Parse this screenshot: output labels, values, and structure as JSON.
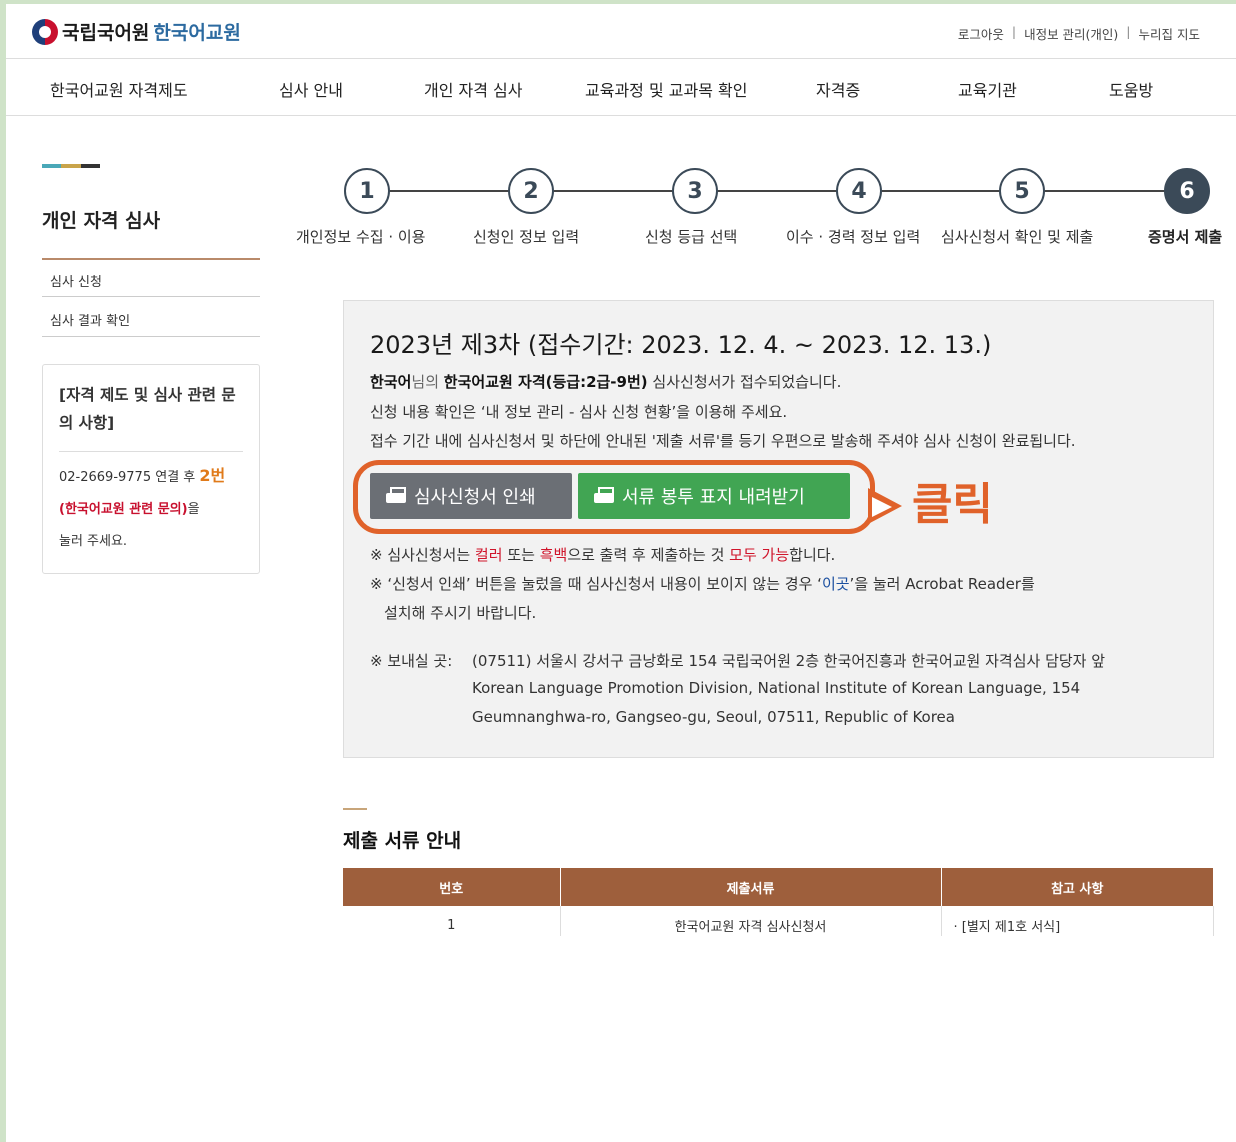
{
  "header": {
    "logo_main": "국립국어원",
    "logo_sub": "한국어교원",
    "util_links": [
      "로그아웃",
      "내정보 관리(개인)",
      "누리집 지도"
    ]
  },
  "gnb": [
    "한국어교원 자격제도",
    "심사 안내",
    "개인 자격 심사",
    "교육과정 및 교과목 확인",
    "자격증",
    "교육기관",
    "도움방"
  ],
  "sidebar": {
    "title": "개인 자격 심사",
    "links": [
      "심사 신청",
      "심사 결과 확인"
    ],
    "box_title": "[자격 제도 및 심사 관련 문의 사항]",
    "phone": "02-2669-9775",
    "phone_mid": "연결 후",
    "ext": "2번",
    "inquiry": "(한국어교원 관련 문의)",
    "inquiry_suffix": "을",
    "press": "눌러 주세요.",
    "deco_colors": [
      "#4aa8b8",
      "#c9a44a",
      "#333333"
    ]
  },
  "steps": [
    {
      "num": "1",
      "label": "개인정보 수집 · 이용"
    },
    {
      "num": "2",
      "label": "신청인 정보 입력"
    },
    {
      "num": "3",
      "label": "신청 등급 선택"
    },
    {
      "num": "4",
      "label": "이수 · 경력 정보 입력"
    },
    {
      "num": "5",
      "label": "심사신청서 확인 및 제출"
    },
    {
      "num": "6",
      "label": "증명서 제출",
      "active": true
    }
  ],
  "main": {
    "title": "2023년 제3차 (접수기간: 2023. 12. 4. ~ 2023. 12. 13.)",
    "line1_name": "한국어",
    "line1_nim": "님의",
    "line1_cert": "한국어교원 자격(등급:2급-9번)",
    "line1_rest": "심사신청서가 접수되었습니다.",
    "line2": "신청 내용 확인은 ‘내 정보 관리 - 심사 신청 현황’을 이용해 주세요.",
    "line3": "접수 기간 내에 심사신청서 및 하단에 안내된 '제출 서류'를 등기 우편으로 발송해 주셔야 심사 신청이 완료됩니다.",
    "btn_print": "심사신청서 인쇄",
    "btn_download": "서류 봉투 표지 내려받기",
    "callout": "클릭",
    "note1_a": "※  심사신청서는",
    "note1_color": "컬러",
    "note1_b": "또는",
    "note1_bw": "흑백",
    "note1_c": "으로 출력 후 제출하는 것",
    "note1_all": "모두 가능",
    "note1_d": "합니다.",
    "note2_a": "※ ‘신청서 인쇄’ 버튼을 눌렀을 때 심사신청서 내용이 보이지 않는 경우 ‘",
    "note2_link": "이곳",
    "note2_b": "’을 눌러 Acrobat Reader를",
    "note2_c": "설치해 주시기 바랍니다.",
    "addr_label": "※ 보내실 곳:",
    "addr_kr": "(07511) 서울시 강서구 금낭화로 154 국립국어원 2층 한국어진흥과 한국어교원 자격심사 담당자 앞",
    "addr_en1": "Korean Language Promotion Division, National Institute of Korean Language, 154",
    "addr_en2": "Geumnanghwa-ro, Gangseo-gu, Seoul, 07511, Republic of Korea"
  },
  "docs": {
    "title": "제출 서류 안내",
    "headers": [
      "번호",
      "제출서류",
      "참고 사항"
    ],
    "rows": [
      [
        "1",
        "한국어교원 자격 심사신청서",
        "· [별지 제1호 서식]"
      ]
    ]
  }
}
